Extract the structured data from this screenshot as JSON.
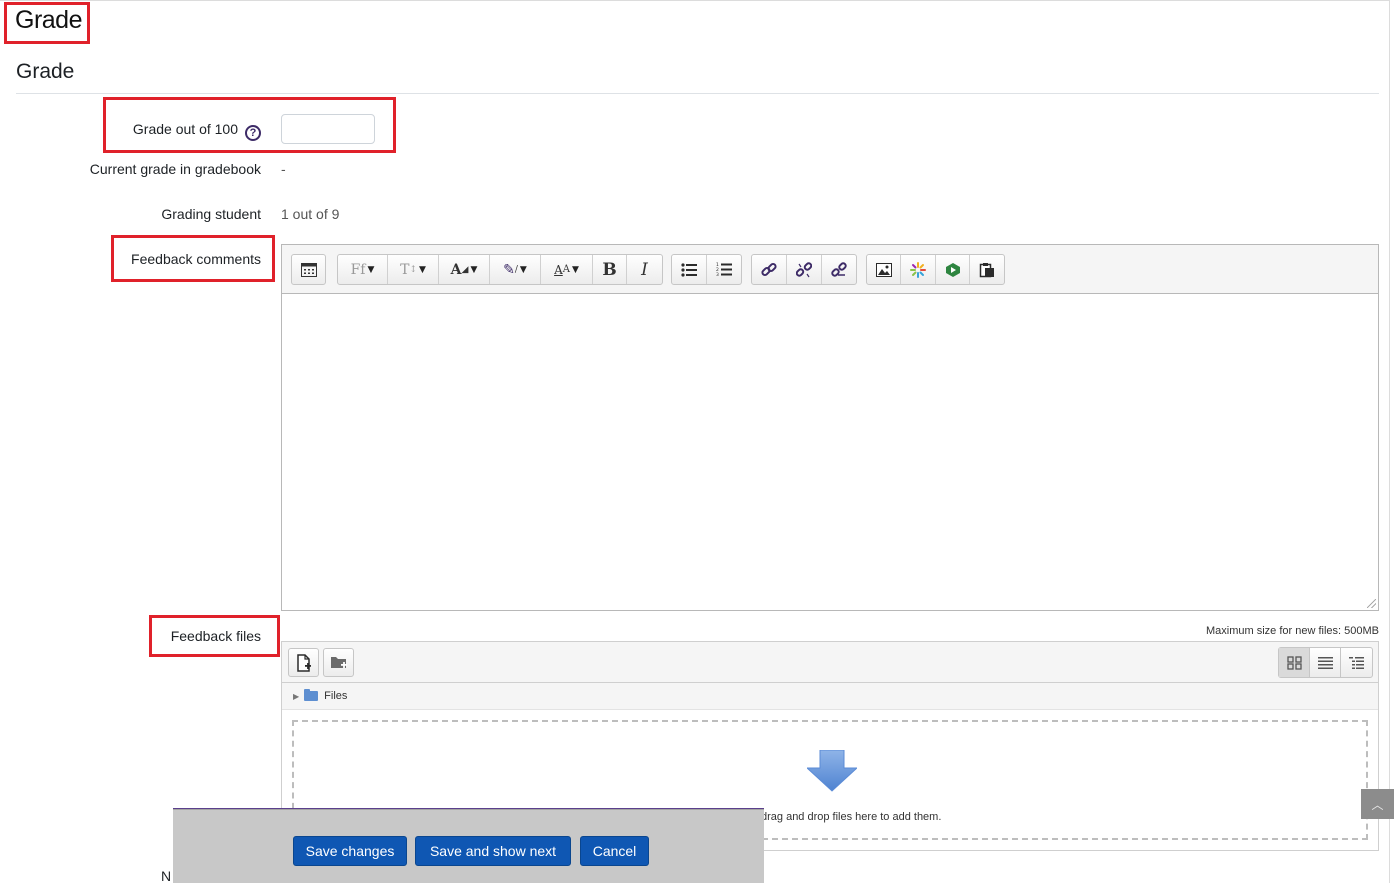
{
  "page": {
    "big_title": "Grade",
    "section_title": "Grade"
  },
  "form": {
    "grade_label": "Grade out of 100",
    "grade_help": "?",
    "grade_value": "",
    "current_grade_label": "Current grade in gradebook",
    "current_grade_value": "-",
    "grading_student_label": "Grading student",
    "grading_student_value": "1 out of 9",
    "feedback_comments_label": "Feedback comments",
    "feedback_files_label": "Feedback files",
    "partial_label": "N"
  },
  "editor": {
    "toolbar_icons": [
      "atto-collapse-icon",
      "font-family-icon",
      "font-size-icon",
      "font-color-icon",
      "highlight-color-icon",
      "text-style-icon",
      "bold-icon",
      "italic-icon",
      "unordered-list-icon",
      "ordered-list-icon",
      "link-icon",
      "unlink-icon",
      "anchor-link-icon",
      "image-icon",
      "media-sparkle-icon",
      "kaltura-icon",
      "paste-icon"
    ],
    "content": ""
  },
  "filemanager": {
    "max_size_text": "Maximum size for new files: 500MB",
    "path_folder": "Files",
    "drop_text": "You can drag and drop files here to add them."
  },
  "actions": {
    "save_changes": "Save changes",
    "save_show_next": "Save and show next",
    "cancel": "Cancel"
  },
  "colors": {
    "annotation": "#e0212a",
    "primary_button": "#0f57b3",
    "icon_accent": "#3d2b67"
  }
}
